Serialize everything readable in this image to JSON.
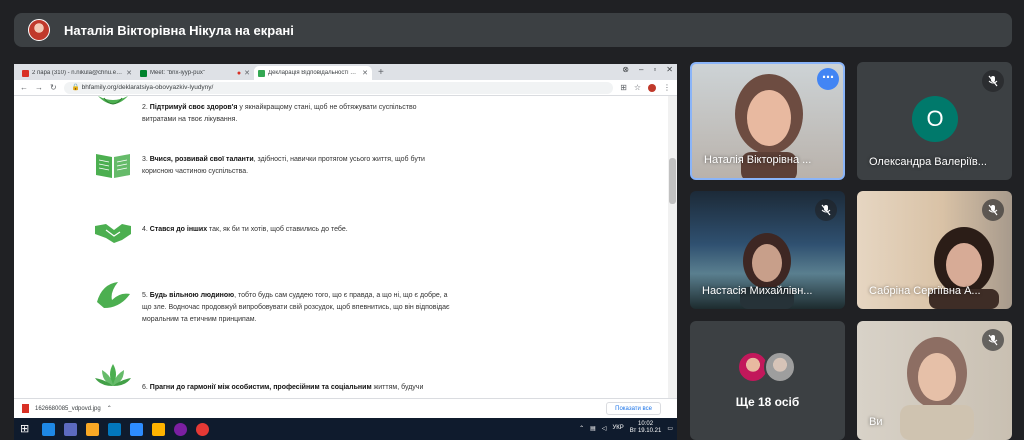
{
  "presenter": {
    "title": "Наталія Вікторівна Нікула на екрані"
  },
  "browser": {
    "tabs": [
      {
        "label": "2 пара (310) - n.nikula@chnu.edu.ua",
        "color": "#d93025"
      },
      {
        "label": "Meet: \"bnx-iyyp-pux\"",
        "color": "#00832d"
      },
      {
        "label": "Декларація Відповідальності Людини",
        "color": "#34a853"
      }
    ],
    "url": "bhfamily.org/deklaratsiya-obovyazkiv-lyudyny/",
    "download_file": "1626680085_vdpovd.jpg",
    "show_all": "Показати все"
  },
  "content": {
    "items": [
      {
        "bold": "Підтримуй своє здоров'я",
        "text": " у якнайкращому стані, щоб не обтяжувати суспільство витратами на твоє лікування.",
        "num": "2. ",
        "icon": "leaf-icon"
      },
      {
        "bold": "Вчися, розвивай свої таланти",
        "text": ", здібності, навички протягом усього життя, щоб бути корисною частиною суспільства.",
        "num": "3. ",
        "icon": "book-icon"
      },
      {
        "bold": "Стався до інших",
        "text": " так, як би ти хотів, щоб ставились до тебе.",
        "num": "4. ",
        "icon": "handshake-icon"
      },
      {
        "bold": "Будь вільною людиною",
        "text": ", тобто будь сам суддею того, що є правда, а що ні, що є добре, а що зле. Водночас продовжуй    випробовувати свій розсудок, щоб впевнитись, що він відповідає моральним та етичним принципам.",
        "num": "5. ",
        "icon": "bird-icon"
      },
      {
        "bold": "Прагни до гармонії між особистим, професійним та соціальним",
        "text": " життям, будучи",
        "num": "6. ",
        "icon": "lotus-icon"
      }
    ]
  },
  "taskbar": {
    "lang": "УКР",
    "time": "10:02",
    "date": "Вт 19.10.21"
  },
  "participants": [
    {
      "name": "Наталія Вікторівна ..."
    },
    {
      "name": "Олександра Валеріїв...",
      "initial": "О"
    },
    {
      "name": "Настасія Михайлівн..."
    },
    {
      "name": "Сабріна Сергіївна А..."
    },
    {
      "name": "Ще 18 осіб"
    },
    {
      "name": "Ви"
    }
  ],
  "colors": {
    "background": "#202124",
    "tile": "#3c4043",
    "accent": "#4285f4",
    "avatar_teal": "#00796b",
    "leaf_green": "#4caf50"
  }
}
